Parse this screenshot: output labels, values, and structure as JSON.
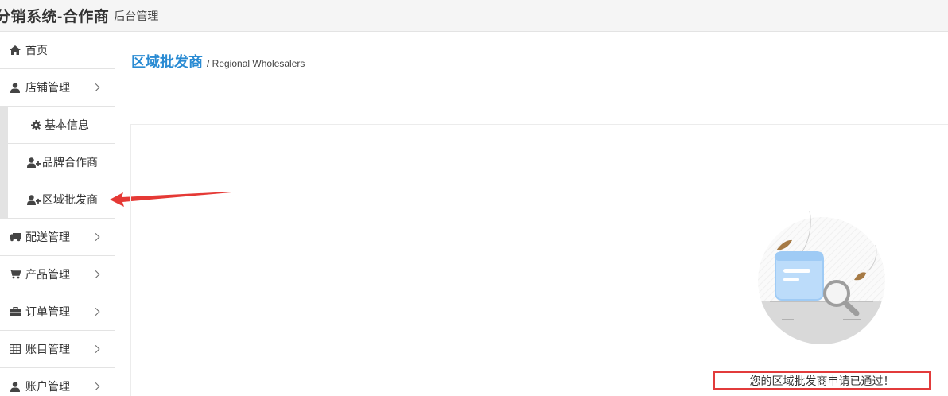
{
  "header": {
    "brand": "分销系统-合作商",
    "subtitle": "后台管理"
  },
  "sidebar": {
    "items": [
      {
        "label": "首页",
        "icon": "home-icon"
      },
      {
        "label": "店铺管理",
        "icon": "user-icon"
      },
      {
        "label": "配送管理",
        "icon": "truck-icon"
      },
      {
        "label": "产品管理",
        "icon": "cart-icon"
      },
      {
        "label": "订单管理",
        "icon": "briefcase-icon"
      },
      {
        "label": "账目管理",
        "icon": "table-icon"
      },
      {
        "label": "账户管理",
        "icon": "user-icon"
      }
    ],
    "sub_items": [
      {
        "label": "基本信息",
        "icon": "gear-icon"
      },
      {
        "label": "品牌合作商",
        "icon": "user-plus-icon"
      },
      {
        "label": "区域批发商",
        "icon": "user-plus-icon"
      }
    ]
  },
  "main": {
    "title": "区域批发商",
    "subtitle": "/ Regional Wholesalers",
    "status_message": "您的区域批发商申请已通过！"
  },
  "colors": {
    "accent": "#2a8bd3",
    "highlight": "#e23b3b"
  }
}
